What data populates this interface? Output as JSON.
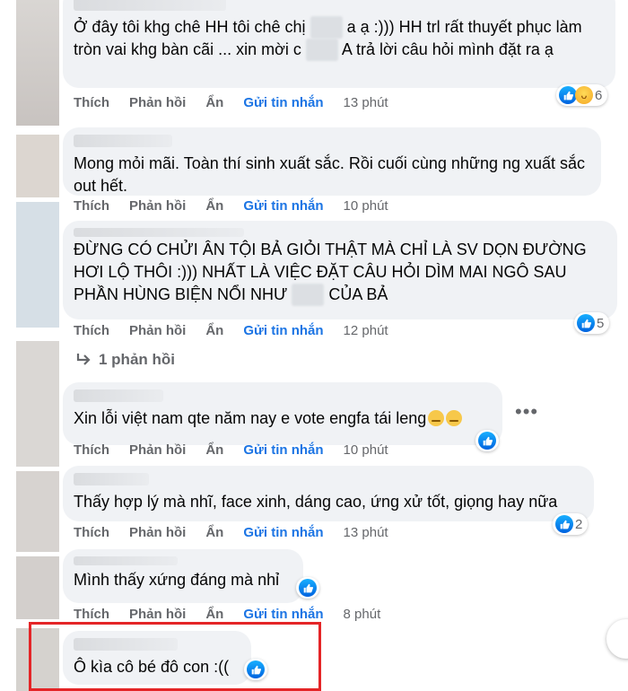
{
  "actions": {
    "like": "Thích",
    "reply": "Phản hồi",
    "hide": "Ẩn",
    "message": "Gửi tin nhắn"
  },
  "comments": [
    {
      "text_parts": [
        "Ở đây tôi khg chê HH tôi chê chị ",
        " a ạ :))) HH trl rất thuyết phục làm tròn vai khg bàn cãi ... xin mời c ",
        " A trả lời câu hỏi mình đặt ra ạ"
      ],
      "time": "13 phút",
      "reaction_count": "6"
    },
    {
      "text": "Mong mỏi mãi. Toàn thí sinh xuất sắc. Rồi cuối cùng những ng xuất sắc out hết.",
      "time": "10 phút"
    },
    {
      "text_parts": [
        "ĐỪNG CÓ CHỬI ÂN TỘI BẢ GIỎI THẬT MÀ CHỈ LÀ SV DỌN ĐƯỜNG HƠI LỘ THÔI :))) NHẤT LÀ VIỆC ĐẶT CÂU HỎI DÌM MAI NGÔ SAU PHẦN HÙNG BIỆN NỔI NHƯ ",
        " CỦA BẢ"
      ],
      "time": "12 phút",
      "reaction_count": "5",
      "replies_label": "1 phản hồi"
    },
    {
      "text": "Xin lỗi việt nam qte năm nay e vote engfa tái leng",
      "time": "10 phút"
    },
    {
      "text": "Thấy hợp lý mà nhĩ, face xinh, dáng cao, ứng xử tốt, giọng hay nữa",
      "time": "13 phút",
      "reaction_count": "2"
    },
    {
      "text": "Mình thấy xứng đáng mà nhỉ",
      "time": "8 phút"
    },
    {
      "text": "Ô kìa cô bé đô con :(("
    }
  ],
  "colors": {
    "bubble": "#f0f2f5",
    "action_text": "#65676b",
    "message_link": "#1b74e4",
    "highlight": "#e42527"
  },
  "icons": [
    "like-icon",
    "haha-icon",
    "reply-arrow-icon",
    "more-options-icon",
    "pensive-emoji-icon"
  ]
}
